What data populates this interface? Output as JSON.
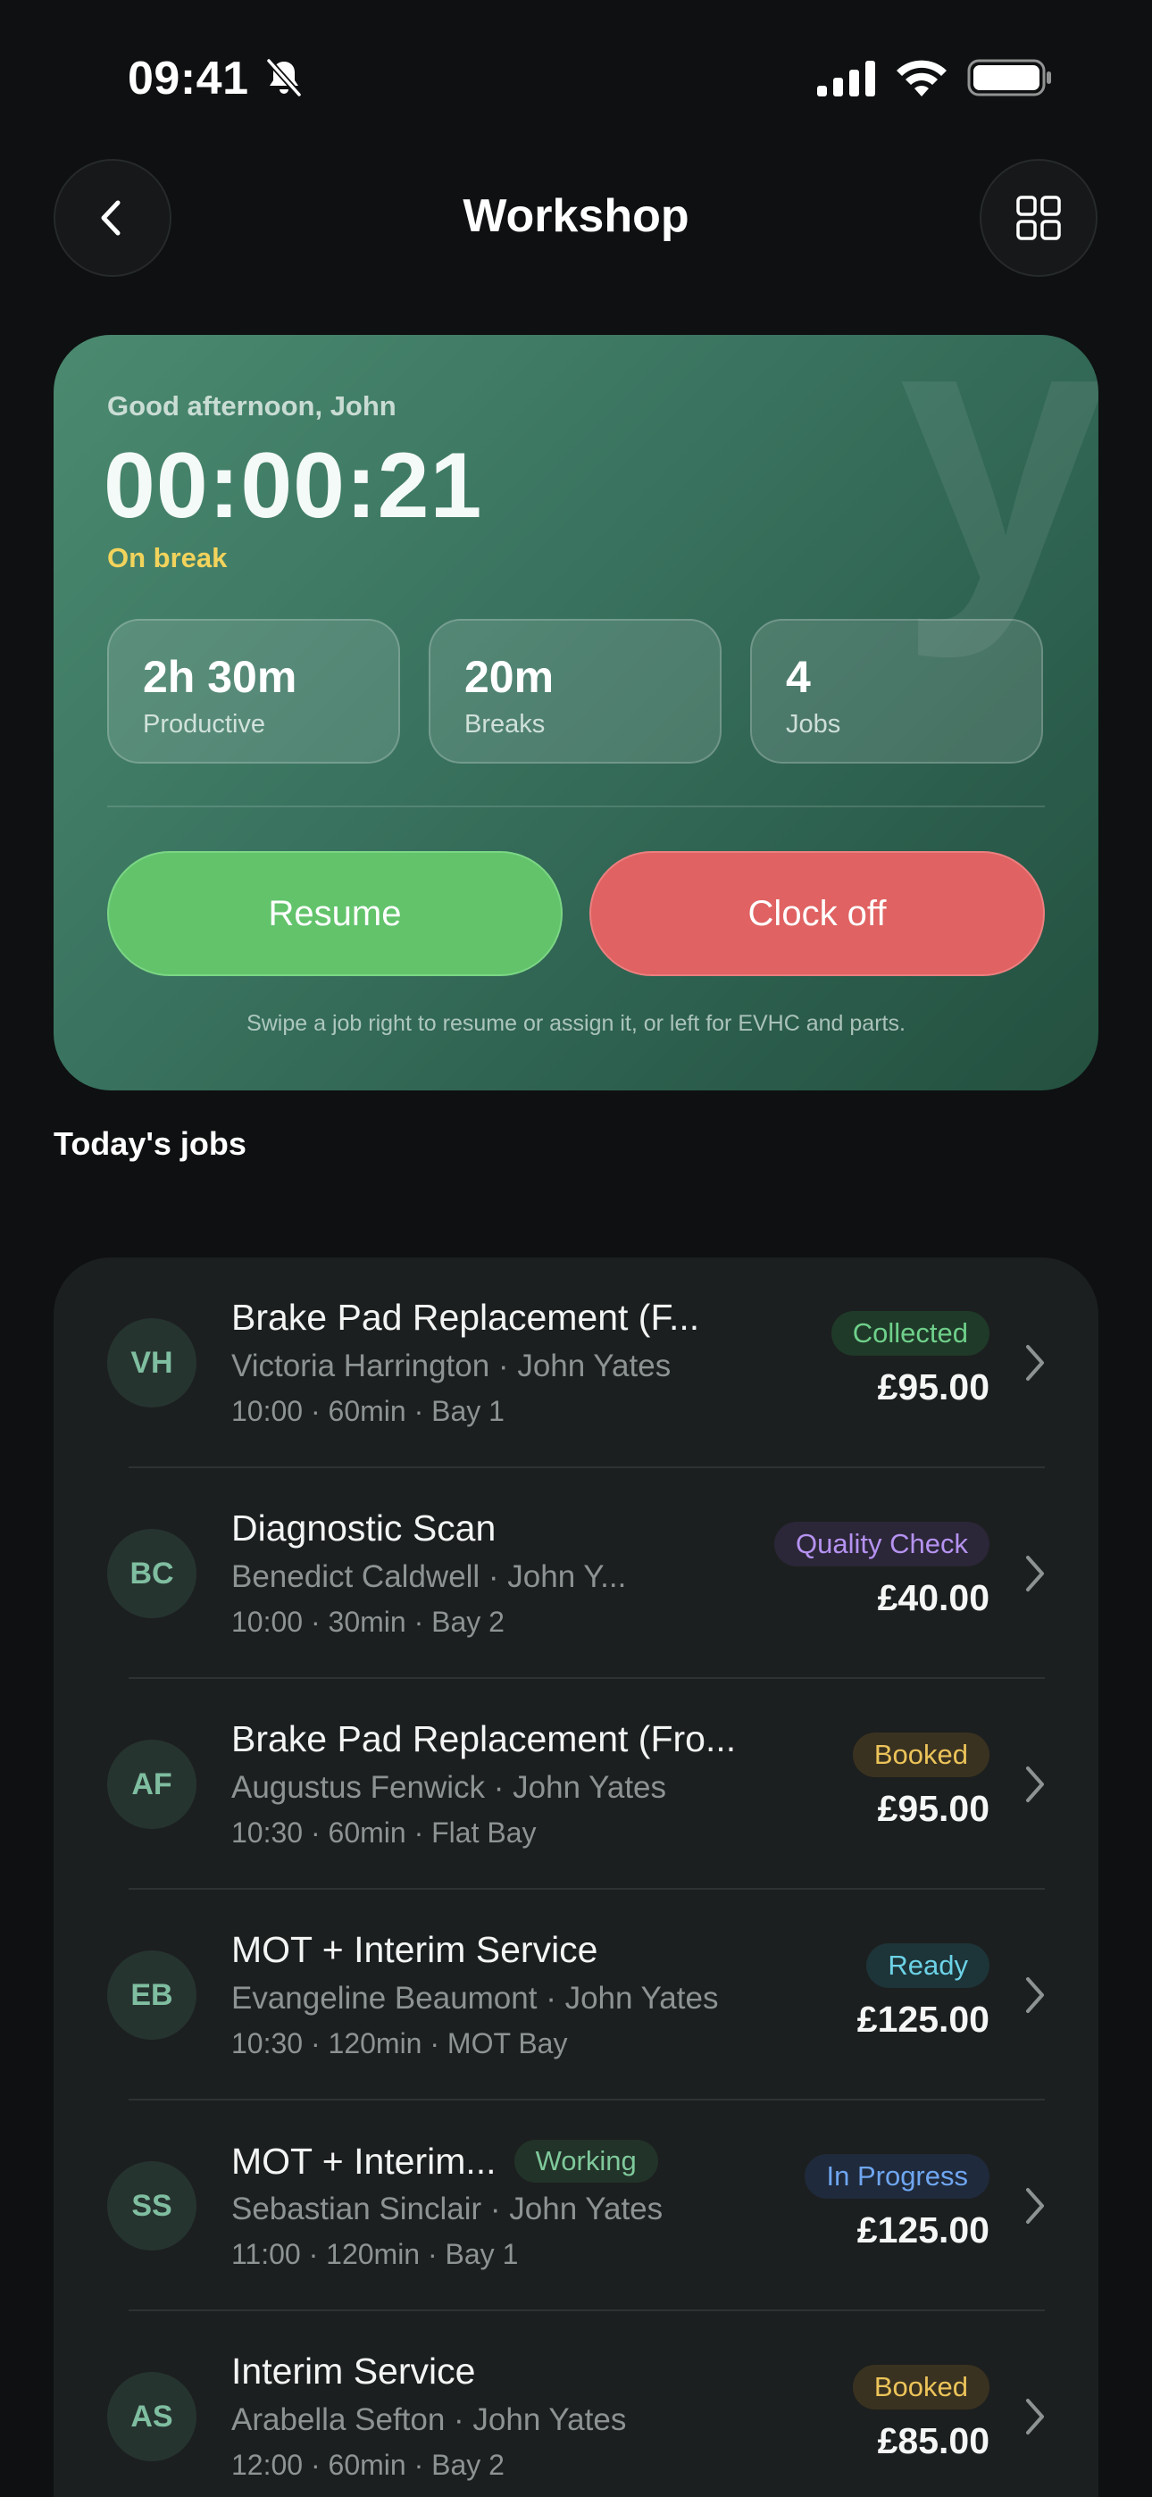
{
  "status_bar": {
    "time": "09:41"
  },
  "header": {
    "title": "Workshop"
  },
  "timer_card": {
    "watermark": "y",
    "greeting": "Good afternoon, John",
    "timer": "00:00:21",
    "status": "On break",
    "stats": [
      {
        "value": "2h 30m",
        "label": "Productive"
      },
      {
        "value": "20m",
        "label": "Breaks"
      },
      {
        "value": "4",
        "label": "Jobs"
      }
    ],
    "resume_label": "Resume",
    "clock_off_label": "Clock off",
    "hint": "Swipe a job right to resume or assign it, or left for EVHC and parts."
  },
  "jobs_section": {
    "title": "Today's jobs"
  },
  "jobs": [
    {
      "initials": "VH",
      "title": "Brake Pad Replacement (F...",
      "sub": "Victoria Harrington · John Yates",
      "meta": "10:00  ·  60min  ·  Bay 1",
      "status": "Collected",
      "status_color": "#6fd08a",
      "status_bg": "#1f3a29",
      "price": "£95.00"
    },
    {
      "initials": "BC",
      "title": "Diagnostic Scan",
      "sub": "Benedict Caldwell · John Y...",
      "meta": "10:00  ·  30min  ·  Bay 2",
      "status": "Quality Check",
      "status_color": "#b592f0",
      "status_bg": "#2b2638",
      "price": "£40.00"
    },
    {
      "initials": "AF",
      "title": "Brake Pad Replacement (Fro...",
      "sub": "Augustus Fenwick · John Yates",
      "meta": "10:30  ·  60min  ·  Flat Bay",
      "status": "Booked",
      "status_color": "#ecc45a",
      "status_bg": "#3a3220",
      "price": "£95.00"
    },
    {
      "initials": "EB",
      "title": "MOT + Interim Service",
      "sub": "Evangeline Beaumont · John Yates",
      "meta": "10:30  ·  120min  ·  MOT Bay",
      "status": "Ready",
      "status_color": "#6cd2e6",
      "status_bg": "#1d3438",
      "price": "£125.00"
    },
    {
      "initials": "SS",
      "title": "MOT + Interim...",
      "badge": "Working",
      "sub": "Sebastian Sinclair · John Yates",
      "meta": "11:00  ·  120min  ·  Bay 1",
      "status": "In Progress",
      "status_color": "#6fa6f0",
      "status_bg": "#1f2a3c",
      "price": "£125.00"
    },
    {
      "initials": "AS",
      "title": "Interim Service",
      "sub": "Arabella Sefton · John Yates",
      "meta": "12:00  ·  60min  ·  Bay 2",
      "status": "Booked",
      "status_color": "#ecc45a",
      "status_bg": "#3a3220",
      "price": "£85.00"
    }
  ]
}
